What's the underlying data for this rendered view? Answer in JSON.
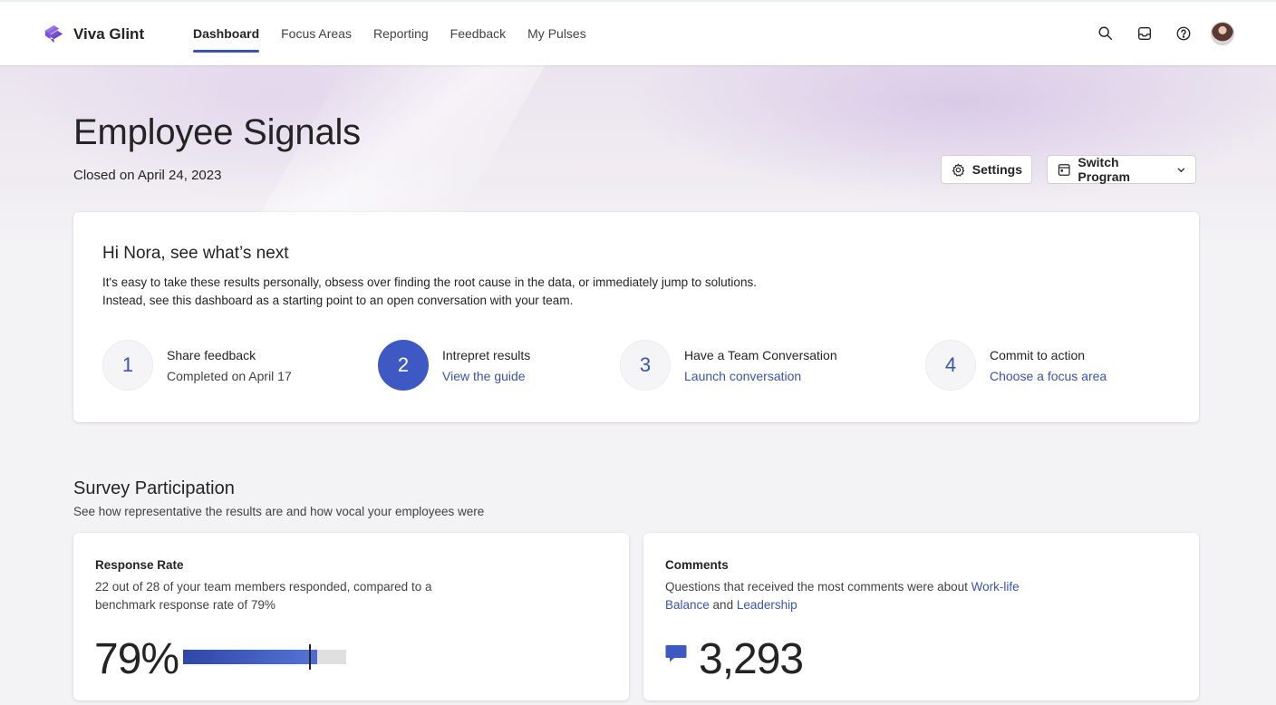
{
  "brand": {
    "name": "Viva Glint",
    "logo_icon": "viva-glint-logo"
  },
  "nav": {
    "items": [
      {
        "label": "Dashboard",
        "active": true
      },
      {
        "label": "Focus Areas",
        "active": false
      },
      {
        "label": "Reporting",
        "active": false
      },
      {
        "label": "Feedback",
        "active": false
      },
      {
        "label": "My Pulses",
        "active": false
      }
    ]
  },
  "top_icons": [
    "search-icon",
    "inbox-icon",
    "help-icon",
    "avatar"
  ],
  "page": {
    "title": "Employee Signals",
    "subtitle": "Closed on April 24, 2023"
  },
  "toolbar": {
    "settings_label": "Settings",
    "switch_label": "Switch Program"
  },
  "next": {
    "greeting": "Hi Nora, see what’s next",
    "intro_line1": "It's easy to take these results personally, obsess over finding the root cause in the data, or immediately jump to solutions.",
    "intro_line2": "Instead, see this dashboard as a starting point to an open conversation with your team.",
    "steps": [
      {
        "num": "1",
        "title": "Share feedback",
        "sub": "Completed on April 17",
        "link": ""
      },
      {
        "num": "2",
        "title": "Intrepret results",
        "sub": "",
        "link": "View the guide"
      },
      {
        "num": "3",
        "title": "Have a Team Conversation",
        "sub": "",
        "link": "Launch conversation"
      },
      {
        "num": "4",
        "title": "Commit to action",
        "sub": "",
        "link": "Choose a focus area"
      }
    ],
    "active_step": 2
  },
  "participation": {
    "title": "Survey Participation",
    "subtitle": "See how representative the results are and how vocal your employees were",
    "response": {
      "heading": "Response Rate",
      "desc_line1": "22 out of 28 of your team members responded, compared to a",
      "desc_line2": "benchmark response rate of 79%",
      "value": "79%",
      "rate_fraction": 0.79,
      "benchmark_fraction": 0.79
    },
    "comments": {
      "heading": "Comments",
      "desc_prefix": "Questions that received the most comments were about ",
      "link1": "Work-life",
      "link1b": "Balance",
      "desc_and": " and ",
      "link2": "Leadership",
      "value": "3,293"
    }
  },
  "colors": {
    "accent": "#3a54b4",
    "active_step": "#3e58c4",
    "background": "#f3f2f4"
  }
}
